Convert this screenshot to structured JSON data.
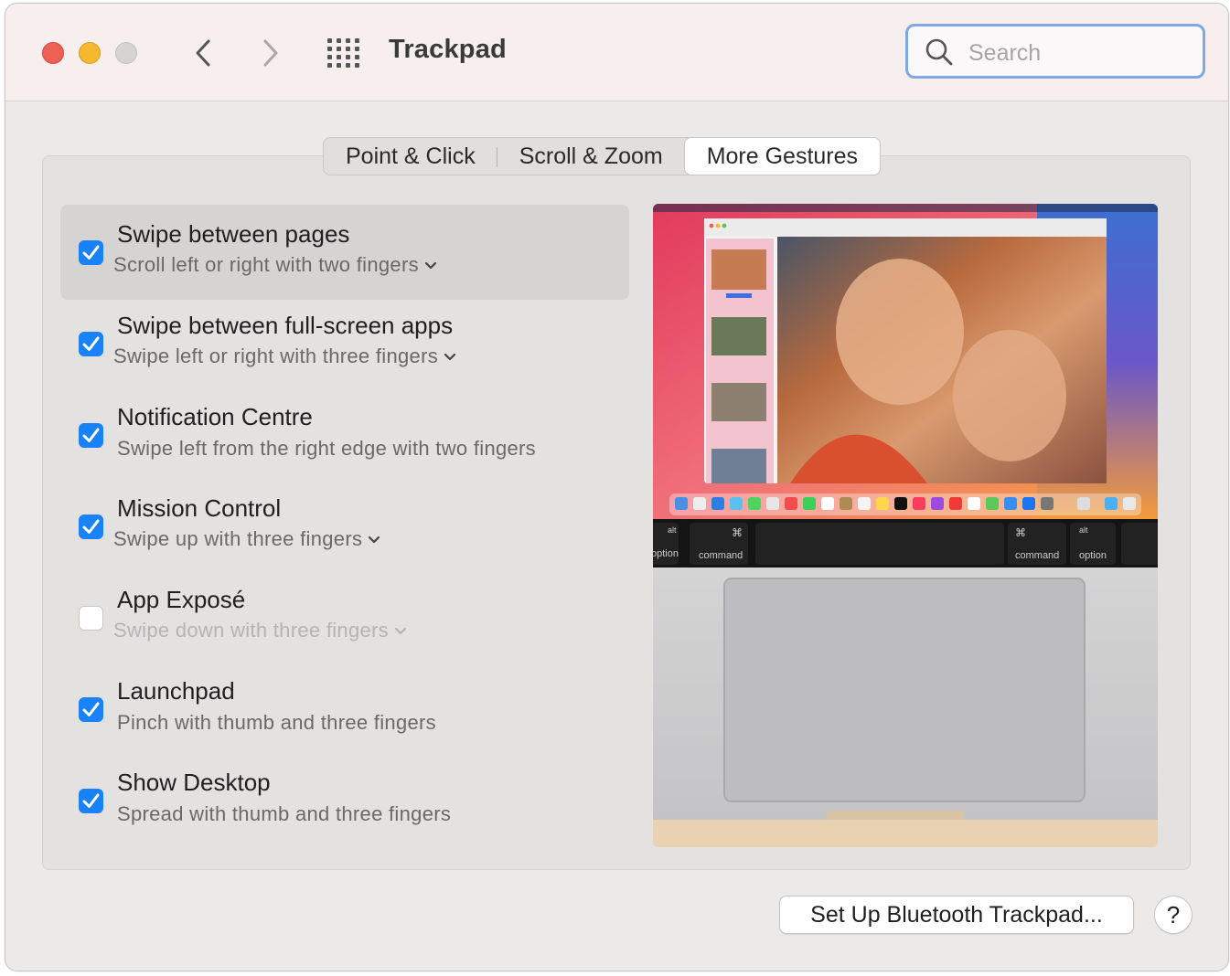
{
  "window": {
    "title": "Trackpad"
  },
  "search": {
    "placeholder": "Search"
  },
  "tabs": [
    {
      "label": "Point & Click",
      "active": false
    },
    {
      "label": "Scroll & Zoom",
      "active": false
    },
    {
      "label": "More Gestures",
      "active": true
    }
  ],
  "gestures": [
    {
      "title": "Swipe between pages",
      "subtitle": "Scroll left or right with two fingers",
      "checked": true,
      "has_menu": true,
      "selected": true
    },
    {
      "title": "Swipe between full-screen apps",
      "subtitle": "Swipe left or right with three fingers",
      "checked": true,
      "has_menu": true,
      "selected": false
    },
    {
      "title": "Notification Centre",
      "subtitle": "Swipe left from the right edge with two fingers",
      "checked": true,
      "has_menu": false,
      "selected": false
    },
    {
      "title": "Mission Control",
      "subtitle": "Swipe up with three fingers",
      "checked": true,
      "has_menu": true,
      "selected": false
    },
    {
      "title": "App Exposé",
      "subtitle": "Swipe down with three fingers",
      "checked": false,
      "has_menu": true,
      "selected": false
    },
    {
      "title": "Launchpad",
      "subtitle": "Pinch with thumb and three fingers",
      "checked": true,
      "has_menu": false,
      "selected": false
    },
    {
      "title": "Show Desktop",
      "subtitle": "Spread with thumb and three fingers",
      "checked": true,
      "has_menu": false,
      "selected": false
    }
  ],
  "preview": {
    "keys": {
      "left_alt": "alt",
      "left_option": "option",
      "command_symbol": "⌘",
      "command": "command",
      "right_alt": "alt",
      "right_option": "option"
    }
  },
  "buttons": {
    "setup": "Set Up Bluetooth Trackpad...",
    "help": "?"
  },
  "colors": {
    "accent": "#1a82f7",
    "search_focus": "#7fa7ea",
    "selected_row": "#d6d3d3"
  }
}
